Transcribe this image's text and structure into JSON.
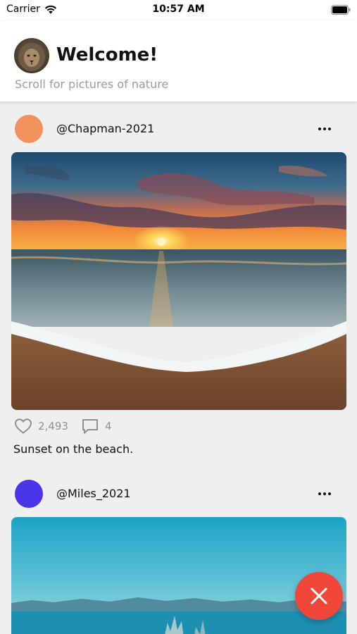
{
  "status_bar": {
    "carrier": "Carrier",
    "time": "10:57 AM",
    "icons": [
      "wifi-icon",
      "battery-icon"
    ]
  },
  "header": {
    "title": "Welcome!",
    "subtitle": "Scroll for pictures of nature",
    "avatar_icon": "lion-profile-avatar"
  },
  "posts": [
    {
      "username": "@Chapman-2021",
      "avatar_color": "#f0915e",
      "image": "sunset-beach-photo",
      "likes": "2,493",
      "comments": "4",
      "caption": "Sunset on the beach."
    },
    {
      "username": "@Miles_2021",
      "avatar_color": "#4a34e8",
      "image": "blue-sea-mountains-photo"
    }
  ],
  "fab": {
    "icon": "close-icon",
    "color": "#f1473a"
  }
}
